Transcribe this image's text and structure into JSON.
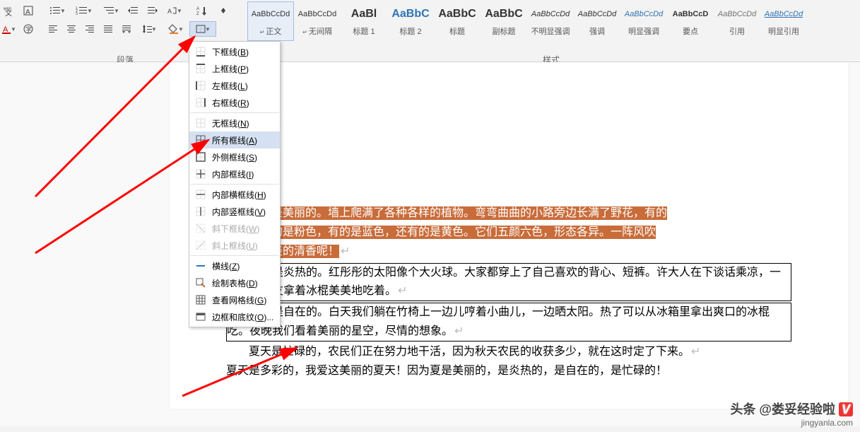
{
  "ribbon": {
    "paragraph_group_label": "段落",
    "styles_group_label": "样式",
    "styles": [
      {
        "preview": "AaBbCcDd",
        "class": "",
        "name": "正文",
        "arrow": true
      },
      {
        "preview": "AaBbCcDd",
        "class": "",
        "name": "无间隔",
        "arrow": true
      },
      {
        "preview": "AaBl",
        "class": "big",
        "name": "标题 1",
        "arrow": false
      },
      {
        "preview": "AaBbC",
        "class": "big blue",
        "name": "标题 2",
        "arrow": false
      },
      {
        "preview": "AaBbC",
        "class": "big",
        "name": "标题",
        "arrow": false
      },
      {
        "preview": "AaBbC",
        "class": "big",
        "name": "副标题",
        "arrow": false
      },
      {
        "preview": "AaBbCcDd",
        "class": "italic",
        "name": "不明显强调",
        "arrow": false
      },
      {
        "preview": "AaBbCcDd",
        "class": "italic",
        "name": "强调",
        "arrow": false
      },
      {
        "preview": "AaBbCcDd",
        "class": "italic blue",
        "name": "明显强调",
        "arrow": false
      },
      {
        "preview": "AaBbCcD",
        "class": "bold",
        "name": "要点",
        "arrow": false
      },
      {
        "preview": "AaBbCcDd",
        "class": "italic grey",
        "name": "引用",
        "arrow": false
      },
      {
        "preview": "AaBbCcDd",
        "class": "italic underline blue",
        "name": "明显引用",
        "arrow": false
      }
    ]
  },
  "border_menu": {
    "items": [
      {
        "id": "bottom",
        "label": "下框线",
        "key": "B",
        "icon": "bottom",
        "disabled": false
      },
      {
        "id": "top",
        "label": "上框线",
        "key": "P",
        "icon": "top",
        "disabled": false
      },
      {
        "id": "left",
        "label": "左框线",
        "key": "L",
        "icon": "left",
        "disabled": false
      },
      {
        "id": "right",
        "label": "右框线",
        "key": "R",
        "icon": "right",
        "disabled": false
      },
      {
        "sep": true
      },
      {
        "id": "none",
        "label": "无框线",
        "key": "N",
        "icon": "none",
        "disabled": false
      },
      {
        "id": "all",
        "label": "所有框线",
        "key": "A",
        "icon": "all",
        "disabled": false,
        "highlight": true
      },
      {
        "id": "outside",
        "label": "外侧框线",
        "key": "S",
        "icon": "outside",
        "disabled": false
      },
      {
        "id": "inside",
        "label": "内部框线",
        "key": "I",
        "icon": "inside",
        "disabled": false
      },
      {
        "sep": true
      },
      {
        "id": "hinside",
        "label": "内部横框线",
        "key": "H",
        "icon": "hinside",
        "disabled": false
      },
      {
        "id": "vinside",
        "label": "内部竖框线",
        "key": "V",
        "icon": "vinside",
        "disabled": false
      },
      {
        "id": "diagdown",
        "label": "斜下框线",
        "key": "W",
        "icon": "diag",
        "disabled": true
      },
      {
        "id": "diagup",
        "label": "斜上框线",
        "key": "U",
        "icon": "diag2",
        "disabled": true
      },
      {
        "sep": true
      },
      {
        "id": "hline",
        "label": "横线",
        "key": "Z",
        "icon": "hline",
        "disabled": false
      },
      {
        "id": "drawtable",
        "label": "绘制表格",
        "key": "D",
        "icon": "draw",
        "disabled": false
      },
      {
        "id": "viewgrid",
        "label": "查看网格线",
        "key": "G",
        "icon": "grid",
        "disabled": false
      },
      {
        "id": "bshading",
        "label": "边框和底纹",
        "key": "O",
        "icon": "dialog",
        "disabled": false,
        "ellipsis": true
      }
    ]
  },
  "doc": {
    "p1a": "夏天是美丽的。墙上爬满了各种各样的植物。弯弯曲曲的小路旁边长满了野花，有的",
    "p1b": "紫色，有的是粉色，有的是蓝色，还有的是黄色。它们五颜六色，形态各异。一阵风吹",
    "p1c": "还会有淡淡的清香呢！",
    "p2": "夏天是炎热的。红彤彤的太阳像个大火球。大家都穿上了自己喜欢的背心、短裤。许大人在下谈话乘凉，一旁的小朋友拿着冰棍美美地吃着。",
    "p3": "夏天是自在的。白天我们躺在竹椅上一边儿哼着小曲儿，一边晒太阳。热了可以从冰箱里拿出爽口的冰棍吃。夜晚我们看着美丽的星空，尽情的想象。",
    "p4": "夏天是忙碌的，农民们正在努力地干活，因为秋天农民的收获多少，就在这时定了下来。",
    "p5": "夏天是多彩的，我爱这美丽的夏天！因为夏是美丽的，是炎热的，是自在的，是忙碌的！",
    "ret": "↵"
  },
  "watermark": {
    "line1": "头条 @娄妥经验啦",
    "line2": "jingyanla.com"
  }
}
